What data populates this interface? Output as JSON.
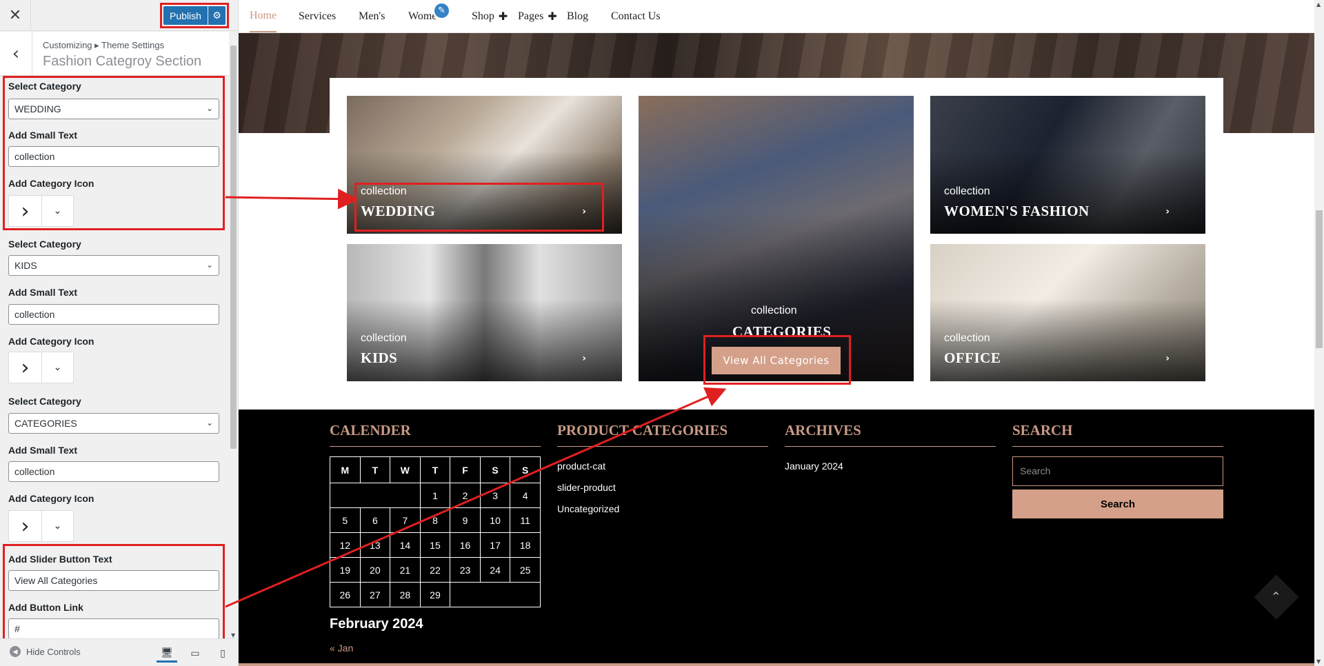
{
  "customizer": {
    "close_label": "✕",
    "publish_label": "Publish",
    "breadcrumb": "Customizing ▸ Theme Settings",
    "section_title": "Fashion Categroy Section",
    "groups": [
      {
        "cat_label": "Select Category",
        "cat_value": "WEDDING",
        "small_label": "Add Small Text",
        "small_value": "collection",
        "icon_label": "Add Category Icon"
      },
      {
        "cat_label": "Select Category",
        "cat_value": "KIDS",
        "small_label": "Add Small Text",
        "small_value": "collection",
        "icon_label": "Add Category Icon"
      },
      {
        "cat_label": "Select Category",
        "cat_value": "CATEGORIES",
        "small_label": "Add Small Text",
        "small_value": "collection",
        "icon_label": "Add Category Icon"
      }
    ],
    "slider_button_label": "Add Slider Button Text",
    "slider_button_value": "View All Categories",
    "button_link_label": "Add Button Link",
    "button_link_value": "#",
    "hide_controls": "Hide Controls"
  },
  "nav": {
    "items": [
      "Home",
      "Services",
      "Men's",
      "Wome",
      "Shop",
      "Pages",
      "Blog",
      "Contact Us"
    ]
  },
  "categories": [
    {
      "small": "collection",
      "title": "WEDDING",
      "image": "bride-in-white-gown"
    },
    {
      "small": "collection",
      "title": "CATEGORIES",
      "image": "woman-with-mask-textile-shop"
    },
    {
      "small": "collection",
      "title": "WOMEN'S FASHION",
      "image": "man-in-suit"
    },
    {
      "small": "collection",
      "title": "KIDS",
      "image": "dress-on-mannequin"
    },
    {
      "small": "collection",
      "title": "OFFICE",
      "image": "bridal-shoes"
    }
  ],
  "view_all_label": "View All Categories",
  "footer": {
    "calender_title": "CALENDER",
    "weekdays": [
      "M",
      "T",
      "W",
      "T",
      "F",
      "S",
      "S"
    ],
    "weeks": [
      [
        "",
        "",
        "",
        "1",
        "2",
        "3",
        "4"
      ],
      [
        "5",
        "6",
        "7",
        "8",
        "9",
        "10",
        "11"
      ],
      [
        "12",
        "13",
        "14",
        "15",
        "16",
        "17",
        "18"
      ],
      [
        "19",
        "20",
        "21",
        "22",
        "23",
        "24",
        "25"
      ],
      [
        "26",
        "27",
        "28",
        "29",
        "",
        "",
        ""
      ]
    ],
    "month": "February 2024",
    "prev": "« Jan",
    "product_title": "PRODUCT CATEGORIES",
    "product_links": [
      "product-cat",
      "slider-product",
      "Uncategorized"
    ],
    "archives_title": "ARCHIVES",
    "archives_links": [
      "January 2024"
    ],
    "search_title": "SEARCH",
    "search_placeholder": "Search",
    "search_button": "Search"
  },
  "colors": {
    "accent": "#c99a85",
    "publish": "#2271b1",
    "highlight": "#e02020"
  }
}
